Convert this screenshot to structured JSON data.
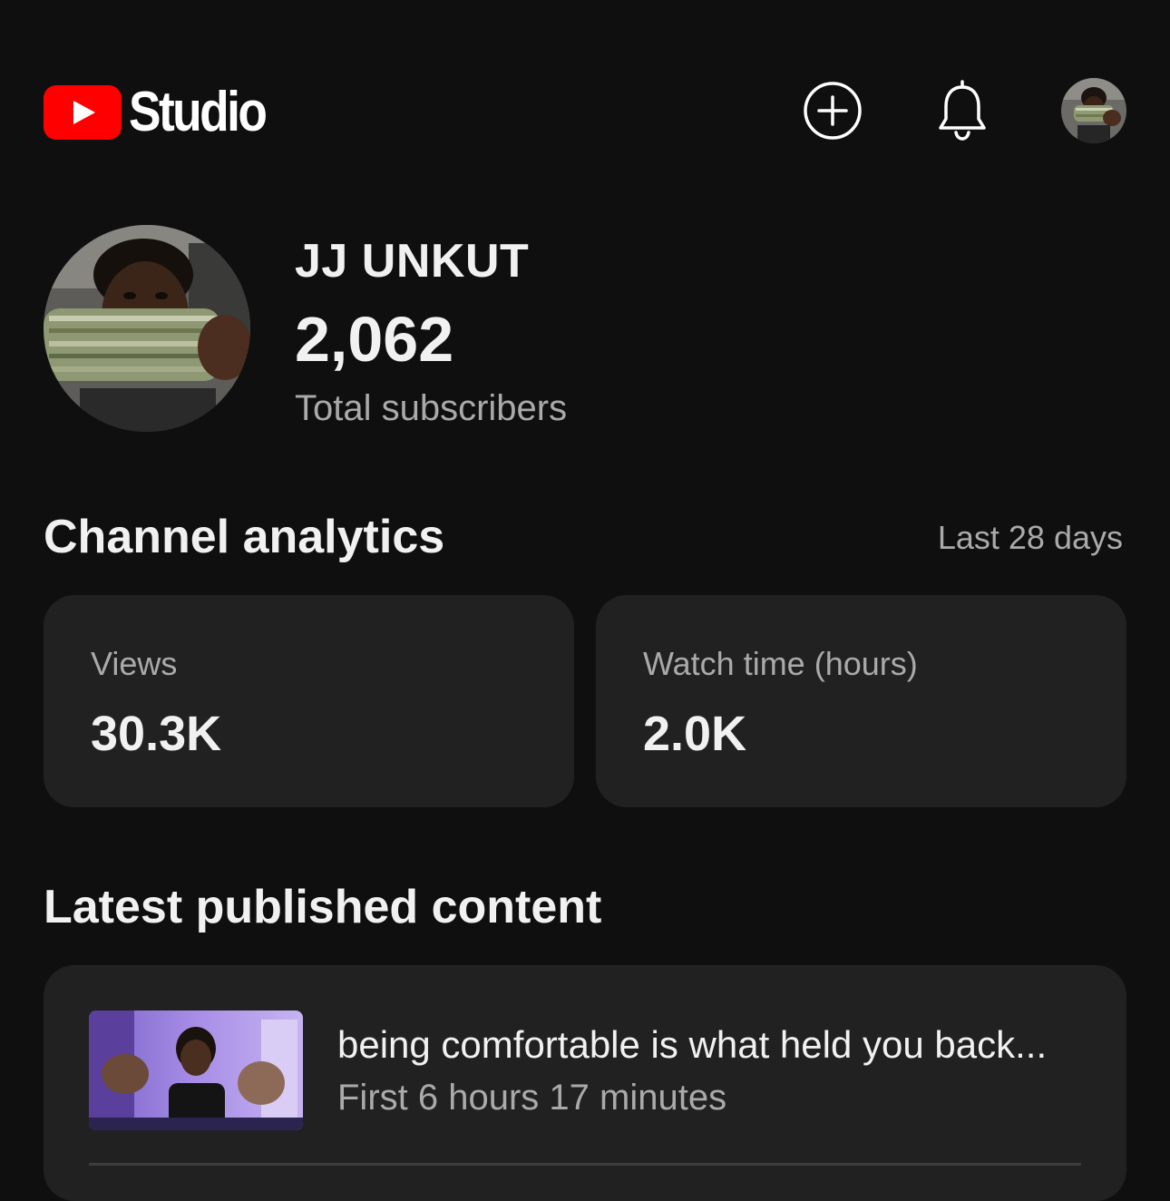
{
  "app": {
    "logo_text": "Studio",
    "brand_color": "#ff0000"
  },
  "header": {
    "icons": [
      "create-icon",
      "bell-icon",
      "account-avatar"
    ]
  },
  "channel": {
    "name": "JJ UNKUT",
    "subscriber_count": "2,062",
    "subscriber_label": "Total subscribers"
  },
  "analytics": {
    "title": "Channel analytics",
    "period": "Last 28 days",
    "metrics": [
      {
        "label": "Views",
        "value": "30.3K"
      },
      {
        "label": "Watch time (hours)",
        "value": "2.0K"
      }
    ]
  },
  "latest": {
    "title": "Latest published content",
    "video": {
      "title": "being comfortable is what held you back...",
      "meta": "First 6 hours 17 minutes"
    }
  }
}
